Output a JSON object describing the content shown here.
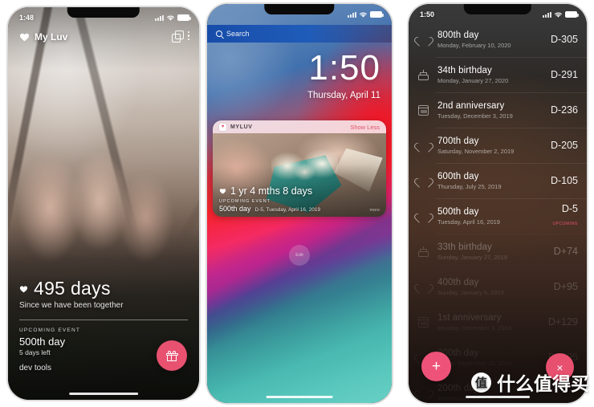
{
  "app": {
    "name": "My Luv",
    "widget_name": "MYLUV"
  },
  "phone1": {
    "status": {
      "time": "1:48"
    },
    "title": "My Luv",
    "icons": {
      "heart": "heart-icon",
      "layers": "layers-icon",
      "menu": "overflow-menu-icon"
    },
    "counter": "495 days",
    "counter_sub": "Since we have been together",
    "section_label": "UPCOMING EVENT",
    "event_title": "500th day",
    "event_sub": "5 days left",
    "dev_tools": "dev tools",
    "fab": {
      "name": "add-event-button",
      "icon": "gift-icon",
      "color": "#e8516f"
    }
  },
  "phone2": {
    "status": {
      "time": ""
    },
    "search_placeholder": "Search",
    "clock": "1:50",
    "date": "Thursday, April 11",
    "widget": {
      "app_label": "MYLUV",
      "show_less": "Show Less",
      "duration": "1 yr 4 mths 8 days",
      "section_label": "UPCOMING EVENT",
      "event_title": "500th day",
      "event_detail": "D-5, Tuesday, April 16, 2019",
      "more": "more"
    },
    "badge": "Edit"
  },
  "phone3": {
    "status": {
      "time": "1:50"
    },
    "events": [
      {
        "icon": "heart-icon",
        "title": "800th day",
        "date": "Monday, February 10, 2020",
        "dday": "D-305",
        "tag": "",
        "fade": ""
      },
      {
        "icon": "cake-icon",
        "title": "34th birthday",
        "date": "Monday, January 27, 2020",
        "dday": "D-291",
        "tag": "",
        "fade": ""
      },
      {
        "icon": "calendar-icon",
        "title": "2nd anniversary",
        "date": "Tuesday, December 3, 2019",
        "dday": "D-236",
        "tag": "",
        "fade": ""
      },
      {
        "icon": "heart-icon",
        "title": "700th day",
        "date": "Saturday, November 2, 2019",
        "dday": "D-205",
        "tag": "",
        "fade": ""
      },
      {
        "icon": "heart-icon",
        "title": "600th day",
        "date": "Thursday, July 25, 2019",
        "dday": "D-105",
        "tag": "",
        "fade": ""
      },
      {
        "icon": "heart-icon",
        "title": "500th day",
        "date": "Tuesday, April 16, 2019",
        "dday": "D-5",
        "tag": "UPCOMING",
        "fade": ""
      },
      {
        "icon": "cake-icon",
        "title": "33th birthday",
        "date": "Sunday, January 27, 2019",
        "dday": "D+74",
        "tag": "",
        "fade": "f1"
      },
      {
        "icon": "heart-icon",
        "title": "400th day",
        "date": "Sunday, January 6, 2019",
        "dday": "D+95",
        "tag": "",
        "fade": "f2"
      },
      {
        "icon": "calendar-icon",
        "title": "1st anniversary",
        "date": "Monday, December 3, 2018",
        "dday": "D+129",
        "tag": "",
        "fade": "f3"
      },
      {
        "icon": "heart-icon",
        "title": "300th day",
        "date": "Friday, September 28, 2018",
        "dday": "D+195",
        "tag": "",
        "fade": "f4"
      },
      {
        "icon": "heart-icon",
        "title": "200th day",
        "date": "Wednesday, June 20, 2018",
        "dday": "",
        "tag": "",
        "fade": "f4"
      }
    ],
    "fab_add": {
      "name": "add-button",
      "label": "+",
      "color": "#ee5278"
    },
    "fab_close": {
      "name": "close-button",
      "label": "×",
      "color": "#e8506f"
    }
  },
  "watermark": {
    "logo": "值",
    "text": "什么值得买"
  }
}
